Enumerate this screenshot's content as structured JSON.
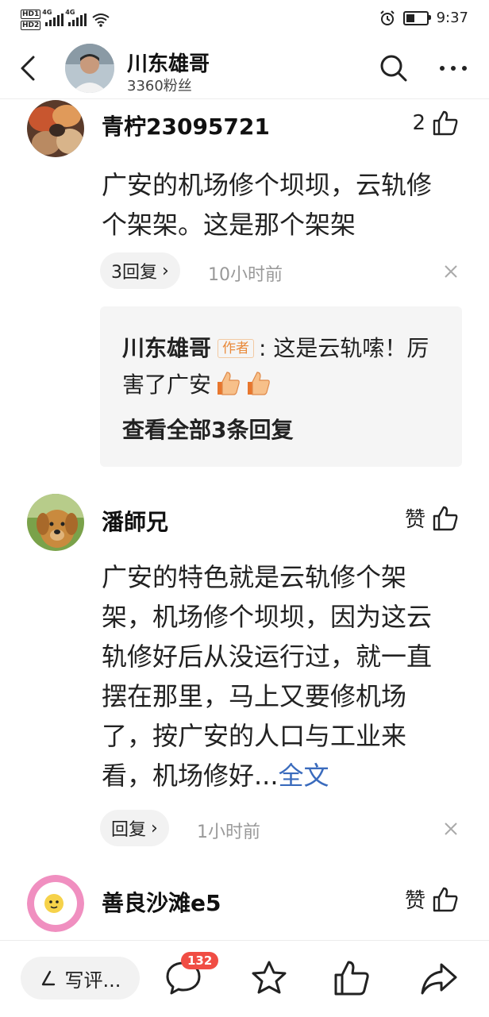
{
  "status_bar": {
    "hd1": "HD1",
    "hd2": "HD2",
    "net1": "4G",
    "net2": "4G",
    "time": "9:37"
  },
  "header": {
    "name": "川东雄哥",
    "fans": "3360粉丝"
  },
  "comments": [
    {
      "user": "青柠23095721",
      "like_count": "2",
      "text": "广安的机场修个坝坝，云轨修个架架。这是那个架架",
      "reply_pill": "3回复",
      "time": "10小时前",
      "sub_reply": {
        "author": "川东雄哥",
        "author_tag": "作者",
        "text": ": 这是云轨嗦！厉害了广安",
        "view_all": "查看全部3条回复"
      }
    },
    {
      "user": "潘師兄",
      "like_count": "赞",
      "text": "广安的特色就是云轨修个架架，机场修个坝坝，因为这云轨修好后从没运行过，就一直摆在那里，马上又要修机场了，按广安的人口与工业来看，机场修好...",
      "full_link": "全文",
      "reply_pill": "回复",
      "time": "1小时前"
    },
    {
      "user": "善良沙滩e5",
      "like_count": "赞"
    }
  ],
  "bottom_bar": {
    "write_label": "写评...",
    "comment_badge": "132"
  },
  "icons": {
    "back": "chevron-left-icon",
    "search": "search-icon",
    "more": "more-dots-icon",
    "like": "thumbs-up-icon",
    "close": "close-icon",
    "comment": "comment-bubble-icon",
    "star": "star-icon",
    "share": "share-arrow-icon"
  },
  "colors": {
    "link": "#3a6bbd",
    "badge": "#f04d44",
    "author_tag": "#e98a3b"
  }
}
